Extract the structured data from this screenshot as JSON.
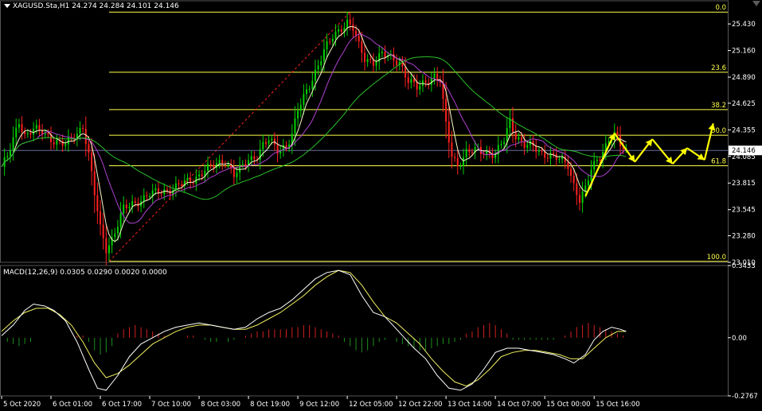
{
  "header": {
    "symbol_info": "XAGUSD.Sta,H1  24.274 24.284 24.101 24.146",
    "macd_info": "MACD(12,26,9) 0.0305 0.0290 0.0020 0.0000"
  },
  "colors": {
    "background": "#000000",
    "bull_candle": "#00d200",
    "bear_candle": "#ff2020",
    "fib_lines": "#ffff4a",
    "forecast_arrows": "#ffff00",
    "ma_fast": "#f8f8c8",
    "ma_mid": "#b040d0",
    "ma_slow": "#28c028",
    "macd_line": "#ffffff",
    "signal_line": "#f0f060",
    "hist_positive": "#d42020",
    "hist_negative": "#1e8e1e",
    "current_price_line": "#6a6aa0"
  },
  "chart_data": [
    {
      "type": "candlestick",
      "title": "XAGUSD.Sta,H1",
      "symbol": "XAGUSD.Sta",
      "timeframe": "H1",
      "ohlc_last": {
        "open": 24.274,
        "high": 24.284,
        "low": 24.101,
        "close": 24.146
      },
      "current_price_label": "24.146",
      "ylim": [
        23.01,
        25.56
      ],
      "y_tick_labels": [
        "25.430",
        "25.160",
        "24.890",
        "24.625",
        "24.355",
        "24.085",
        "23.815",
        "23.545",
        "23.280",
        "23.010"
      ],
      "y_ticks": [
        25.43,
        25.16,
        24.89,
        24.625,
        24.355,
        24.085,
        23.815,
        23.545,
        23.28,
        23.01
      ],
      "x_tick_labels": [
        "5 Oct 2020",
        "6 Oct 01:00",
        "6 Oct 17:00",
        "7 Oct 10:00",
        "8 Oct 03:00",
        "8 Oct 19:00",
        "9 Oct 12:00",
        "12 Oct 05:00",
        "12 Oct 22:00",
        "13 Oct 14:00",
        "14 Oct 07:00",
        "15 Oct 00:00",
        "15 Oct 16:00"
      ],
      "x_tick_bars": [
        0,
        17,
        34,
        51,
        68,
        85,
        102,
        119,
        136,
        153,
        170,
        187,
        204
      ],
      "fibonacci": {
        "levels": [
          {
            "label": "0.0",
            "price": 25.55
          },
          {
            "label": "23.6",
            "price": 24.94
          },
          {
            "label": "38.2",
            "price": 24.56
          },
          {
            "label": "50.0",
            "price": 24.3
          },
          {
            "label": "61.8",
            "price": 23.99
          },
          {
            "label": "100.0",
            "price": 23.02
          }
        ],
        "anchor_low": {
          "bar": 37,
          "price": 23.02
        },
        "anchor_high": {
          "bar": 120,
          "price": 25.55
        }
      },
      "close_points": [
        [
          0,
          23.98
        ],
        [
          2,
          24.08
        ],
        [
          4,
          24.25
        ],
        [
          6,
          24.45
        ],
        [
          8,
          24.3
        ],
        [
          11,
          24.36
        ],
        [
          14,
          24.33
        ],
        [
          18,
          24.25
        ],
        [
          22,
          24.2
        ],
        [
          26,
          24.32
        ],
        [
          28,
          24.4
        ],
        [
          30,
          24.1
        ],
        [
          32,
          23.7
        ],
        [
          34,
          23.35
        ],
        [
          36,
          23.15
        ],
        [
          38,
          23.25
        ],
        [
          40,
          23.4
        ],
        [
          42,
          23.55
        ],
        [
          45,
          23.6
        ],
        [
          48,
          23.65
        ],
        [
          51,
          23.7
        ],
        [
          54,
          23.72
        ],
        [
          58,
          23.75
        ],
        [
          62,
          23.8
        ],
        [
          66,
          23.85
        ],
        [
          70,
          23.95
        ],
        [
          74,
          24.0
        ],
        [
          77,
          24.05
        ],
        [
          80,
          23.9
        ],
        [
          82,
          23.95
        ],
        [
          85,
          24.05
        ],
        [
          88,
          24.1
        ],
        [
          90,
          24.2
        ],
        [
          92,
          24.25
        ],
        [
          95,
          24.15
        ],
        [
          98,
          24.2
        ],
        [
          100,
          24.3
        ],
        [
          102,
          24.55
        ],
        [
          105,
          24.75
        ],
        [
          108,
          24.95
        ],
        [
          111,
          25.15
        ],
        [
          114,
          25.3
        ],
        [
          117,
          25.4
        ],
        [
          119,
          25.45
        ],
        [
          121,
          25.38
        ],
        [
          123,
          25.2
        ],
        [
          125,
          25.08
        ],
        [
          128,
          25.05
        ],
        [
          131,
          25.12
        ],
        [
          134,
          25.08
        ],
        [
          137,
          25.05
        ],
        [
          140,
          24.85
        ],
        [
          143,
          24.78
        ],
        [
          146,
          24.85
        ],
        [
          149,
          24.9
        ],
        [
          151,
          24.85
        ],
        [
          153,
          24.4
        ],
        [
          155,
          24.1
        ],
        [
          157,
          24.0
        ],
        [
          160,
          24.12
        ],
        [
          164,
          24.15
        ],
        [
          168,
          24.12
        ],
        [
          170,
          24.1
        ],
        [
          173,
          24.25
        ],
        [
          175,
          24.45
        ],
        [
          177,
          24.3
        ],
        [
          180,
          24.2
        ],
        [
          183,
          24.18
        ],
        [
          186,
          24.12
        ],
        [
          189,
          24.1
        ],
        [
          192,
          24.05
        ],
        [
          195,
          24.0
        ],
        [
          197,
          23.8
        ],
        [
          199,
          23.65
        ],
        [
          201,
          23.75
        ],
        [
          203,
          23.95
        ],
        [
          205,
          24.05
        ],
        [
          207,
          24.15
        ],
        [
          209,
          24.25
        ],
        [
          211,
          24.3
        ],
        [
          213,
          24.2
        ],
        [
          215,
          24.15
        ]
      ],
      "forecast_zigzag": [
        {
          "bar": 201,
          "price": 23.68
        },
        {
          "bar": 211,
          "price": 24.32
        },
        {
          "bar": 218,
          "price": 24.03
        },
        {
          "bar": 224,
          "price": 24.26
        },
        {
          "bar": 231,
          "price": 24.01
        },
        {
          "bar": 236,
          "price": 24.17
        },
        {
          "bar": 242,
          "price": 24.05
        },
        {
          "bar": 245,
          "price": 24.42
        }
      ]
    },
    {
      "type": "line",
      "title": "MACD(12,26,9) 0.0305 0.0290 0.0020 0.0000",
      "ylim": [
        -0.2767,
        0.3433
      ],
      "y_tick_labels": [
        "0.3433",
        "0.00",
        "-0.2767"
      ],
      "y_ticks": [
        0.3433,
        0.0,
        -0.2767
      ],
      "macd_points": [
        [
          0,
          0.01
        ],
        [
          4,
          0.06
        ],
        [
          8,
          0.13
        ],
        [
          11,
          0.16
        ],
        [
          15,
          0.15
        ],
        [
          18,
          0.13
        ],
        [
          22,
          0.08
        ],
        [
          26,
          -0.02
        ],
        [
          30,
          -0.15
        ],
        [
          33,
          -0.24
        ],
        [
          36,
          -0.25
        ],
        [
          40,
          -0.18
        ],
        [
          44,
          -0.09
        ],
        [
          48,
          -0.03
        ],
        [
          52,
          0.0
        ],
        [
          56,
          0.03
        ],
        [
          60,
          0.05
        ],
        [
          64,
          0.06
        ],
        [
          68,
          0.07
        ],
        [
          72,
          0.06
        ],
        [
          76,
          0.05
        ],
        [
          80,
          0.04
        ],
        [
          84,
          0.05
        ],
        [
          88,
          0.09
        ],
        [
          92,
          0.12
        ],
        [
          96,
          0.14
        ],
        [
          100,
          0.18
        ],
        [
          104,
          0.23
        ],
        [
          108,
          0.28
        ],
        [
          112,
          0.31
        ],
        [
          116,
          0.32
        ],
        [
          120,
          0.3
        ],
        [
          124,
          0.2
        ],
        [
          128,
          0.12
        ],
        [
          132,
          0.1
        ],
        [
          136,
          0.04
        ],
        [
          140,
          -0.02
        ],
        [
          142,
          -0.05
        ],
        [
          146,
          -0.1
        ],
        [
          150,
          -0.18
        ],
        [
          154,
          -0.24
        ],
        [
          158,
          -0.25
        ],
        [
          162,
          -0.22
        ],
        [
          166,
          -0.15
        ],
        [
          170,
          -0.07
        ],
        [
          174,
          -0.05
        ],
        [
          178,
          -0.05
        ],
        [
          182,
          -0.06
        ],
        [
          186,
          -0.07
        ],
        [
          190,
          -0.08
        ],
        [
          194,
          -0.1
        ],
        [
          197,
          -0.12
        ],
        [
          201,
          -0.08
        ],
        [
          204,
          -0.01
        ],
        [
          207,
          0.03
        ],
        [
          210,
          0.05
        ],
        [
          213,
          0.04
        ],
        [
          215,
          0.03
        ]
      ],
      "signal_points": [
        [
          0,
          0.03
        ],
        [
          4,
          0.08
        ],
        [
          8,
          0.12
        ],
        [
          12,
          0.14
        ],
        [
          16,
          0.14
        ],
        [
          20,
          0.11
        ],
        [
          24,
          0.06
        ],
        [
          28,
          -0.02
        ],
        [
          32,
          -0.12
        ],
        [
          36,
          -0.19
        ],
        [
          40,
          -0.17
        ],
        [
          44,
          -0.13
        ],
        [
          48,
          -0.08
        ],
        [
          52,
          -0.03
        ],
        [
          56,
          0.0
        ],
        [
          60,
          0.03
        ],
        [
          64,
          0.05
        ],
        [
          68,
          0.06
        ],
        [
          72,
          0.06
        ],
        [
          76,
          0.05
        ],
        [
          80,
          0.04
        ],
        [
          84,
          0.04
        ],
        [
          88,
          0.06
        ],
        [
          92,
          0.09
        ],
        [
          96,
          0.12
        ],
        [
          100,
          0.16
        ],
        [
          104,
          0.2
        ],
        [
          108,
          0.25
        ],
        [
          112,
          0.29
        ],
        [
          116,
          0.32
        ],
        [
          120,
          0.31
        ],
        [
          124,
          0.25
        ],
        [
          128,
          0.17
        ],
        [
          132,
          0.1
        ],
        [
          136,
          0.07
        ],
        [
          140,
          0.02
        ],
        [
          144,
          -0.03
        ],
        [
          148,
          -0.1
        ],
        [
          152,
          -0.16
        ],
        [
          156,
          -0.21
        ],
        [
          160,
          -0.23
        ],
        [
          164,
          -0.2
        ],
        [
          168,
          -0.15
        ],
        [
          172,
          -0.09
        ],
        [
          176,
          -0.07
        ],
        [
          180,
          -0.06
        ],
        [
          184,
          -0.06
        ],
        [
          188,
          -0.07
        ],
        [
          192,
          -0.08
        ],
        [
          196,
          -0.1
        ],
        [
          200,
          -0.1
        ],
        [
          204,
          -0.05
        ],
        [
          208,
          0.0
        ],
        [
          212,
          0.03
        ],
        [
          215,
          0.03
        ]
      ],
      "histogram_bars": [
        [
          2,
          -0.02
        ],
        [
          4,
          -0.03
        ],
        [
          6,
          -0.04
        ],
        [
          8,
          -0.03
        ],
        [
          10,
          -0.02
        ],
        [
          26,
          0.01
        ],
        [
          28,
          0.01
        ],
        [
          30,
          -0.02
        ],
        [
          32,
          -0.06
        ],
        [
          34,
          -0.08
        ],
        [
          36,
          -0.07
        ],
        [
          38,
          -0.04
        ],
        [
          40,
          0.02
        ],
        [
          42,
          0.04
        ],
        [
          44,
          0.05
        ],
        [
          46,
          0.06
        ],
        [
          48,
          0.05
        ],
        [
          50,
          0.04
        ],
        [
          52,
          0.03
        ],
        [
          54,
          0.02
        ],
        [
          56,
          0.01
        ],
        [
          64,
          0.01
        ],
        [
          66,
          0.01
        ],
        [
          70,
          -0.01
        ],
        [
          72,
          -0.02
        ],
        [
          74,
          -0.02
        ],
        [
          78,
          -0.02
        ],
        [
          80,
          -0.01
        ],
        [
          84,
          0.01
        ],
        [
          86,
          0.02
        ],
        [
          88,
          0.03
        ],
        [
          90,
          0.03
        ],
        [
          92,
          0.04
        ],
        [
          94,
          0.04
        ],
        [
          96,
          0.04
        ],
        [
          98,
          0.04
        ],
        [
          100,
          0.05
        ],
        [
          102,
          0.05
        ],
        [
          104,
          0.06
        ],
        [
          106,
          0.06
        ],
        [
          108,
          0.05
        ],
        [
          110,
          0.04
        ],
        [
          112,
          0.03
        ],
        [
          114,
          0.02
        ],
        [
          116,
          0.01
        ],
        [
          118,
          -0.02
        ],
        [
          120,
          -0.04
        ],
        [
          122,
          -0.06
        ],
        [
          124,
          -0.07
        ],
        [
          126,
          -0.06
        ],
        [
          128,
          -0.04
        ],
        [
          130,
          -0.02
        ],
        [
          132,
          -0.01
        ],
        [
          136,
          -0.02
        ],
        [
          138,
          -0.03
        ],
        [
          140,
          -0.04
        ],
        [
          142,
          -0.05
        ],
        [
          144,
          -0.06
        ],
        [
          146,
          -0.06
        ],
        [
          148,
          -0.05
        ],
        [
          150,
          -0.04
        ],
        [
          152,
          -0.03
        ],
        [
          154,
          -0.03
        ],
        [
          156,
          -0.02
        ],
        [
          158,
          -0.01
        ],
        [
          160,
          0.02
        ],
        [
          162,
          0.03
        ],
        [
          164,
          0.05
        ],
        [
          166,
          0.06
        ],
        [
          168,
          0.07
        ],
        [
          170,
          0.06
        ],
        [
          172,
          0.04
        ],
        [
          174,
          0.02
        ],
        [
          176,
          -0.01
        ],
        [
          178,
          -0.01
        ],
        [
          180,
          -0.01
        ],
        [
          182,
          -0.01
        ],
        [
          184,
          -0.01
        ],
        [
          186,
          -0.01
        ],
        [
          188,
          -0.01
        ],
        [
          190,
          -0.01
        ],
        [
          194,
          0.01
        ],
        [
          196,
          0.03
        ],
        [
          198,
          0.05
        ],
        [
          200,
          0.06
        ],
        [
          202,
          0.07
        ],
        [
          204,
          0.06
        ],
        [
          206,
          0.05
        ],
        [
          208,
          0.04
        ],
        [
          210,
          0.03
        ],
        [
          212,
          0.02
        ],
        [
          214,
          0.01
        ]
      ]
    }
  ]
}
